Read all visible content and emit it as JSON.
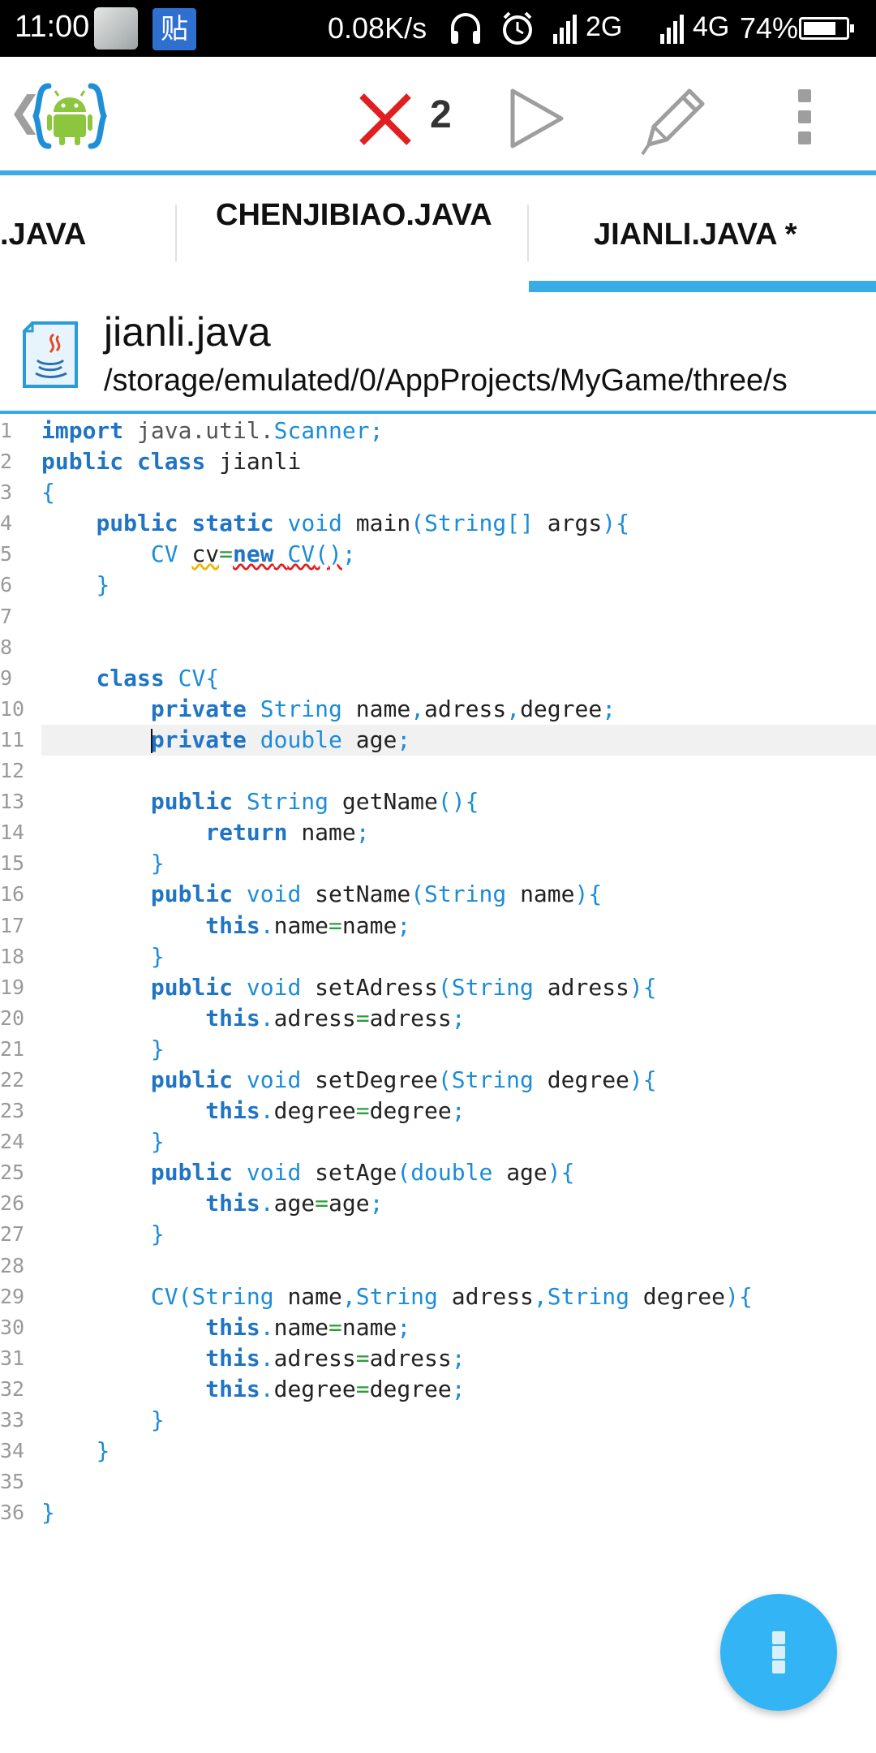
{
  "status_bar": {
    "time": "11:00",
    "app2_glyph": "贴",
    "net_speed": "0.08K/s",
    "signal1": "2G",
    "signal2": "4G",
    "battery_percent": "74%",
    "icons": [
      "gallery-app-icon",
      "tieba-app-icon",
      "headset-icon",
      "alarm-icon",
      "signal-icon",
      "battery-icon"
    ]
  },
  "toolbar": {
    "error_count": "2",
    "icons": [
      "back-chevron-icon",
      "aide-android-logo",
      "error-x-icon",
      "run-play-icon",
      "edit-pencil-icon",
      "overflow-menu-icon"
    ],
    "accent_color": "#3aace5",
    "error_color": "#e02020"
  },
  "tabs": [
    {
      "label": ".JAVA",
      "active": false
    },
    {
      "label": "CHENJIBIAO.JAVA",
      "active": false
    },
    {
      "label": "JIANLI.JAVA *",
      "active": true
    }
  ],
  "file": {
    "name": "jianli.java",
    "path": "/storage/emulated/0/AppProjects/MyGame/three/s"
  },
  "editor": {
    "current_line": 11,
    "lines": [
      "import java.util.Scanner;",
      "public class jianli",
      "{",
      "    public static void main(String[] args){",
      "        CV cv=new CV();",
      "    }",
      "",
      "",
      "    class CV{",
      "        private String name,adress,degree;",
      "        private double age;",
      "",
      "        public String getName(){",
      "            return name;",
      "        }",
      "        public void setName(String name){",
      "            this.name=name;",
      "        }",
      "        public void setAdress(String adress){",
      "            this.adress=adress;",
      "        }",
      "        public void setDegree(String degree){",
      "            this.degree=degree;",
      "        }",
      "        public void setAge(double age){",
      "            this.age=age;",
      "        }",
      "",
      "        CV(String name,String adress,String degree){",
      "            this.name=name;",
      "            this.adress=adress;",
      "            this.degree=degree;",
      "        }",
      "    }",
      "",
      "}"
    ]
  },
  "fab": {
    "icon": "vertical-dots-icon",
    "color": "#33b5f5"
  }
}
